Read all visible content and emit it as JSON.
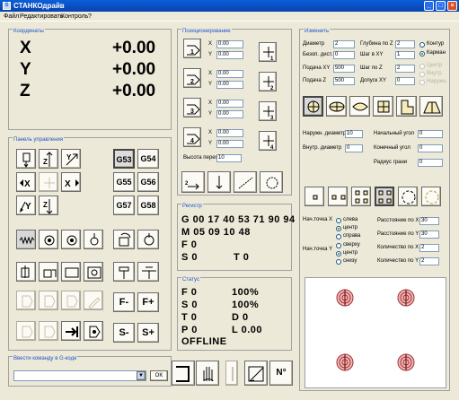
{
  "window": {
    "title": "СТАНКОдрайв"
  },
  "menu": [
    "Файл",
    "Редактировать",
    "Контроль",
    "?"
  ],
  "coords": {
    "title": "Координаты",
    "rows": [
      {
        "axis": "X",
        "value": "+0.00"
      },
      {
        "axis": "Y",
        "value": "+0.00"
      },
      {
        "axis": "Z",
        "value": "+0.00"
      }
    ]
  },
  "control": {
    "title": "Панель управления",
    "g_codes": [
      "G53",
      "G54",
      "G55",
      "G56",
      "G57",
      "G58"
    ],
    "f_minus": "F-",
    "f_plus": "F+",
    "s_minus": "S-",
    "s_plus": "S+"
  },
  "positioning": {
    "title": "Позиционирование",
    "points": [
      "1",
      "2",
      "3",
      "4"
    ],
    "x_label": "X",
    "y_label": "Y",
    "values": [
      "0.00",
      "0.00",
      "0.00",
      "0.00",
      "0.00",
      "0.00",
      "0.00",
      "0.00"
    ],
    "height_label": "Высота перех.",
    "height_value": "10"
  },
  "register": {
    "title": "Регистр",
    "lines": [
      "G 00 17 40 53 71 90 94",
      "M 05 09 10 48",
      "F 0",
      "S 0",
      "T 0"
    ]
  },
  "status": {
    "title": "Статус",
    "rows": [
      {
        "left": "F 0",
        "right": "100%"
      },
      {
        "left": "S 0",
        "right": "100%"
      },
      {
        "left": "T 0",
        "right": "D 0"
      },
      {
        "left": "P 0",
        "right": "L 0.00"
      }
    ],
    "state": "OFFLINE"
  },
  "command": {
    "label": "Ввести команду в G-коде",
    "value": "",
    "ok": "OK"
  },
  "modify": {
    "title": "Изменить",
    "diameter_label": "Диаметр",
    "diameter": "2",
    "depth_z_label": "Глубина по Z",
    "depth_z": "2",
    "safe_dist_label": "Безоп. дист.",
    "safe_dist": "0",
    "step_xy_label": "Шаг в XY",
    "step_xy": "1",
    "feed_xy_label": "Подача XY",
    "feed_xy": "500",
    "step_z_label": "Шаг по Z",
    "step_z": "2",
    "feed_z_label": "Подача Z",
    "feed_z": "500",
    "tol_xy_label": "Допуск XY",
    "tol_xy": "0",
    "mode_options": [
      "Контур",
      "Карман"
    ],
    "cut_options": [
      "Центр",
      "Внутр.",
      "Наружн."
    ],
    "outer_diameter_label": "Наружн. диаметр",
    "outer_diameter": "10",
    "start_angle_label": "Начальный угол",
    "start_angle": "0",
    "inner_diameter_label": "Внутр. диаметр",
    "inner_diameter": "0",
    "end_angle_label": "Конечный угол",
    "end_angle": "0",
    "face_radius_label": "Радиус грани",
    "face_radius": "0",
    "start_x_label": "Нач.точка X",
    "start_x_options": [
      "слева",
      "центр",
      "справа"
    ],
    "start_y_label": "Нач.точка Y",
    "start_y_options": [
      "сверху",
      "центр",
      "снизу"
    ],
    "dist_x_label": "Расстояние по X",
    "dist_x": "30",
    "dist_y_label": "Расстояние по Y",
    "dist_y": "30",
    "count_x_label": "Количество по X",
    "count_x": "2",
    "count_y_label": "Количество по Y",
    "count_y": "2"
  },
  "bottom": {
    "nc_label": "N°"
  }
}
